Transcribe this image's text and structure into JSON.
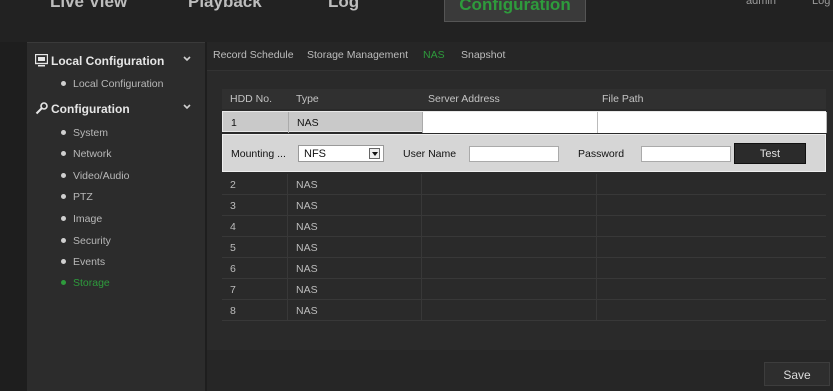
{
  "topnav": {
    "tabs": [
      {
        "label": "Live View"
      },
      {
        "label": "Playback"
      },
      {
        "label": "Log"
      },
      {
        "label": "Configuration"
      }
    ],
    "user": "admin",
    "logout": "Log"
  },
  "sidebar": {
    "local_group": {
      "label": "Local Configuration",
      "icon": "monitor-icon"
    },
    "local_items": [
      {
        "label": "Local Configuration"
      }
    ],
    "config_group": {
      "label": "Configuration",
      "icon": "wrench-icon"
    },
    "config_items": [
      {
        "label": "System"
      },
      {
        "label": "Network"
      },
      {
        "label": "Video/Audio"
      },
      {
        "label": "PTZ"
      },
      {
        "label": "Image"
      },
      {
        "label": "Security"
      },
      {
        "label": "Events"
      },
      {
        "label": "Storage"
      }
    ],
    "active_item": "Storage"
  },
  "subtabs": [
    {
      "label": "Record Schedule"
    },
    {
      "label": "Storage Management"
    },
    {
      "label": "NAS"
    },
    {
      "label": "Snapshot"
    }
  ],
  "active_subtab": "NAS",
  "table": {
    "headers": [
      "HDD No.",
      "Type",
      "Server Address",
      "File Path"
    ],
    "selected_row": {
      "hdd": "1",
      "type": "NAS",
      "server_address": "",
      "file_path": ""
    },
    "detail": {
      "mounting_label": "Mounting ...",
      "mounting_value": "NFS",
      "username_label": "User Name",
      "username_value": "",
      "password_label": "Password",
      "password_value": "",
      "test_label": "Test"
    },
    "rows": [
      {
        "hdd": "2",
        "type": "NAS"
      },
      {
        "hdd": "3",
        "type": "NAS"
      },
      {
        "hdd": "4",
        "type": "NAS"
      },
      {
        "hdd": "5",
        "type": "NAS"
      },
      {
        "hdd": "6",
        "type": "NAS"
      },
      {
        "hdd": "7",
        "type": "NAS"
      },
      {
        "hdd": "8",
        "type": "NAS"
      }
    ]
  },
  "save_label": "Save",
  "colors": {
    "accent": "#2e9b3c",
    "background": "#1e1e1e",
    "panel": "#2a2a2a"
  }
}
